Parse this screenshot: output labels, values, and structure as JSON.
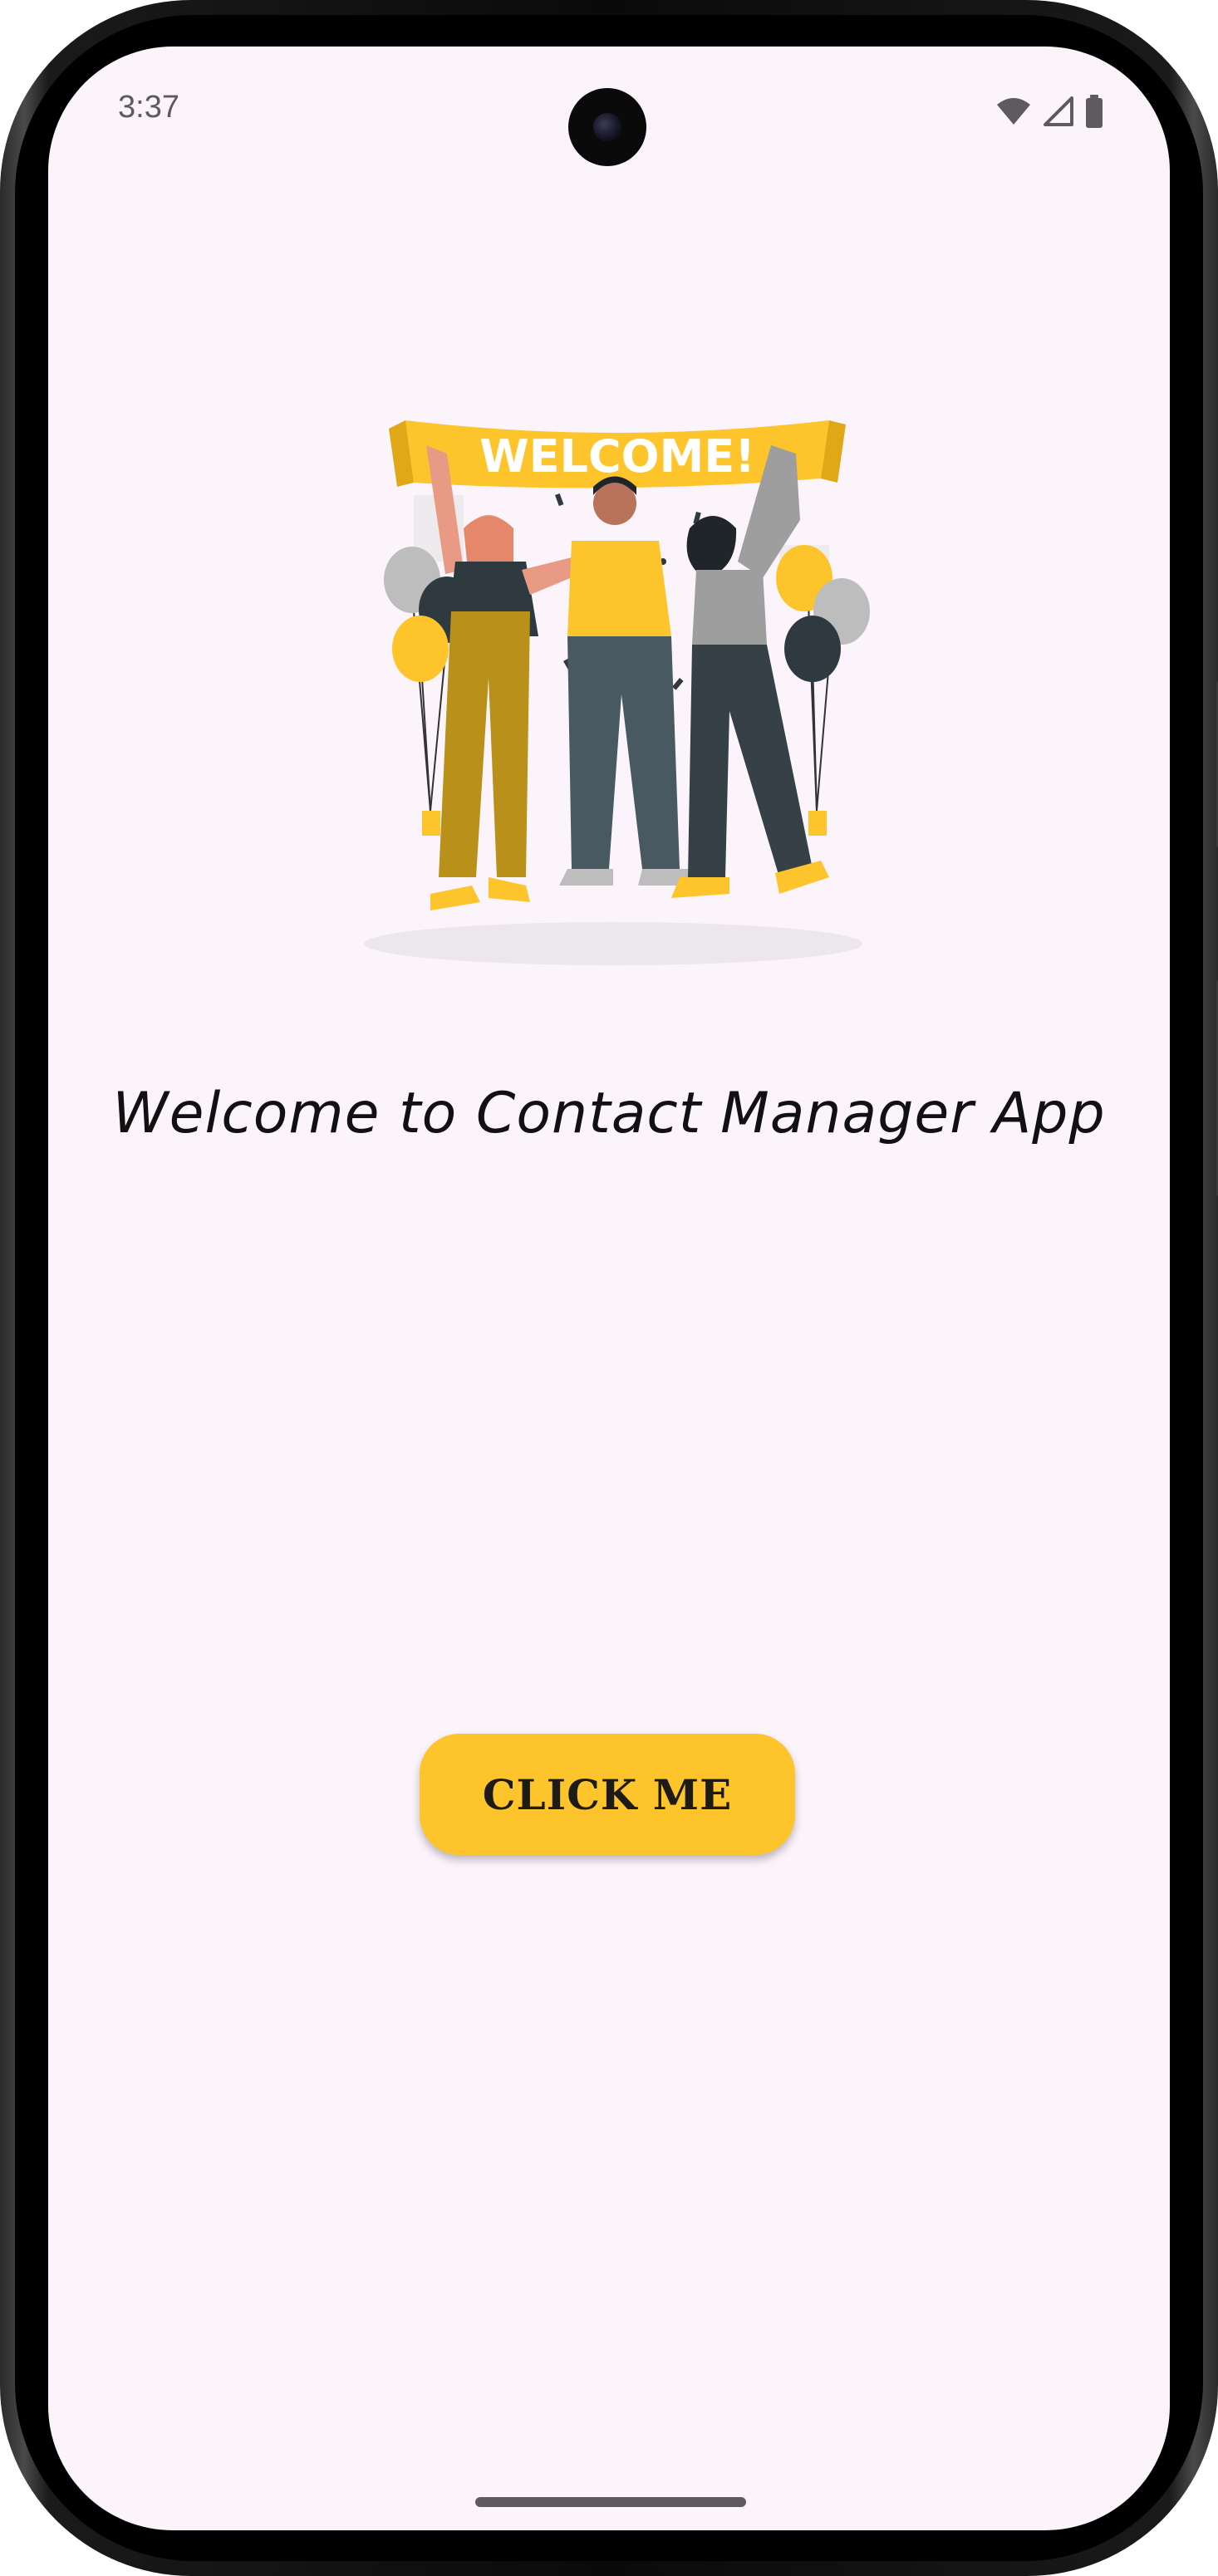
{
  "status_bar": {
    "time": "3:37",
    "icons": [
      "wifi-icon",
      "cellular-signal-icon",
      "battery-icon"
    ]
  },
  "illustration": {
    "banner_text": "WELCOME!"
  },
  "main": {
    "welcome_text": "Welcome to Contact Manager App",
    "button_label": "CLICK ME"
  },
  "colors": {
    "background": "#fcf4fb",
    "accent": "#fdc52b",
    "text": "#111111"
  }
}
